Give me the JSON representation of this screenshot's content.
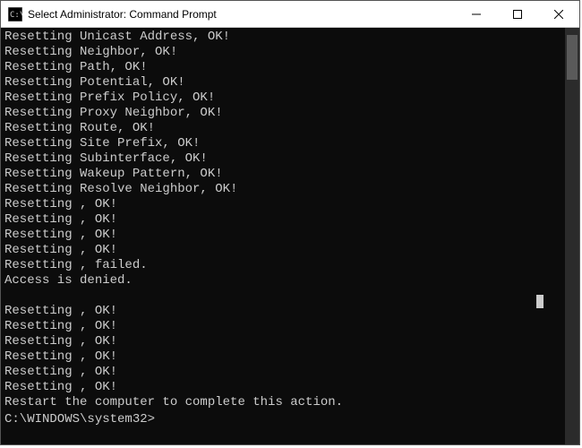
{
  "window": {
    "title": "Select Administrator: Command Prompt"
  },
  "terminal": {
    "lines": [
      "Resetting Unicast Address, OK!",
      "Resetting Neighbor, OK!",
      "Resetting Path, OK!",
      "Resetting Potential, OK!",
      "Resetting Prefix Policy, OK!",
      "Resetting Proxy Neighbor, OK!",
      "Resetting Route, OK!",
      "Resetting Site Prefix, OK!",
      "Resetting Subinterface, OK!",
      "Resetting Wakeup Pattern, OK!",
      "Resetting Resolve Neighbor, OK!",
      "Resetting , OK!",
      "Resetting , OK!",
      "Resetting , OK!",
      "Resetting , OK!",
      "Resetting , failed.",
      "Access is denied.",
      "",
      "Resetting , OK!",
      "Resetting , OK!",
      "Resetting , OK!",
      "Resetting , OK!",
      "Resetting , OK!",
      "Resetting , OK!",
      "Restart the computer to complete this action.",
      ""
    ],
    "prompt": "C:\\WINDOWS\\system32>",
    "input": ""
  }
}
